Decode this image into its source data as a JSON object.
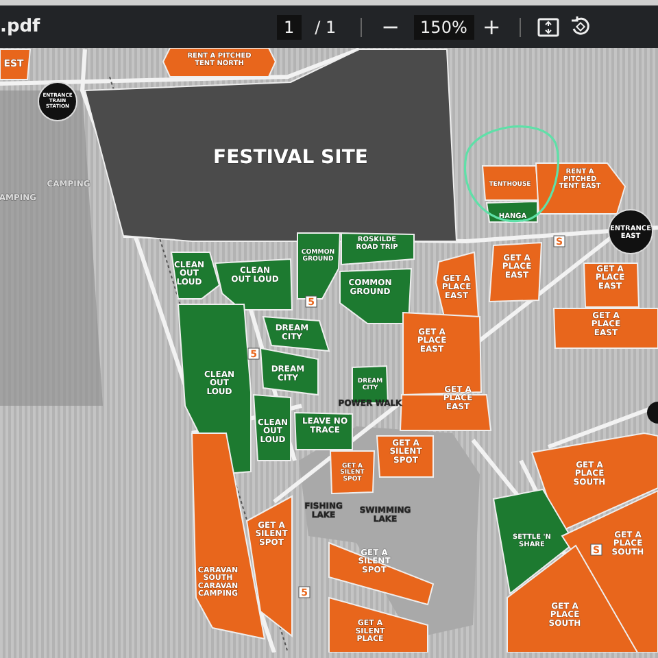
{
  "viewer": {
    "file_name": ".pdf",
    "page": "1",
    "page_total": "/ 1",
    "zoom_out": "−",
    "zoom": "150%",
    "zoom_in": "+"
  },
  "map": {
    "areas": [
      {
        "kind": "camping",
        "lines": [
          "EST"
        ]
      },
      {
        "kind": "camping",
        "lines": [
          "RENT A PITCHED",
          "TENT NORTH"
        ]
      },
      {
        "kind": "site",
        "lines": [
          "FESTIVAL SITE"
        ]
      },
      {
        "kind": "camping",
        "lines": [
          "TENTHOUSE"
        ]
      },
      {
        "kind": "camping",
        "lines": [
          "RENT A",
          "PITCHED",
          "TENT EAST"
        ]
      },
      {
        "kind": "green",
        "lines": [
          "HANGA"
        ]
      },
      {
        "kind": "green",
        "lines": [
          "CLEAN",
          "OUT",
          "LOUD"
        ]
      },
      {
        "kind": "green",
        "lines": [
          "CLEAN",
          "OUT LOUD"
        ]
      },
      {
        "kind": "green",
        "lines": [
          "COMMON",
          "GROUND"
        ]
      },
      {
        "kind": "green",
        "lines": [
          "ROSKILDE",
          "ROAD TRIP"
        ]
      },
      {
        "kind": "green",
        "lines": [
          "COMMON",
          "GROUND"
        ]
      },
      {
        "kind": "camping",
        "lines": [
          "GET A",
          "PLACE",
          "EAST"
        ]
      },
      {
        "kind": "camping",
        "lines": [
          "GET A",
          "PLACE",
          "EAST"
        ]
      },
      {
        "kind": "camping",
        "lines": [
          "GET A",
          "PLACE",
          "EAST"
        ]
      },
      {
        "kind": "camping",
        "lines": [
          "GET A",
          "PLACE",
          "EAST"
        ]
      },
      {
        "kind": "green",
        "lines": [
          "DREAM",
          "CITY"
        ]
      },
      {
        "kind": "green",
        "lines": [
          "CLEAN",
          "OUT",
          "LOUD"
        ]
      },
      {
        "kind": "green",
        "lines": [
          "DREAM",
          "CITY"
        ]
      },
      {
        "kind": "green",
        "lines": [
          "DREAM",
          "CITY"
        ]
      },
      {
        "kind": "green",
        "lines": [
          "CLEAN",
          "OUT",
          "LOUD"
        ]
      },
      {
        "kind": "green",
        "lines": [
          "LEAVE NO",
          "TRACE"
        ]
      },
      {
        "kind": "camping",
        "lines": [
          "GET A",
          "PLACE",
          "EAST"
        ]
      },
      {
        "kind": "camping",
        "lines": [
          "GET A",
          "PLACE",
          "EAST"
        ]
      },
      {
        "kind": "camping",
        "lines": [
          "GET A",
          "SILENT",
          "SPOT"
        ]
      },
      {
        "kind": "camping",
        "lines": [
          "GET A",
          "SILENT",
          "SPOT"
        ]
      },
      {
        "kind": "camping",
        "lines": [
          "GET A",
          "PLACE",
          "SOUTH"
        ]
      },
      {
        "kind": "camping",
        "lines": [
          "GET A",
          "SILENT",
          "SPOT"
        ]
      },
      {
        "kind": "green",
        "lines": [
          "SETTLE 'N",
          "SHARE"
        ]
      },
      {
        "kind": "camping",
        "lines": [
          "GET A",
          "PLACE",
          "SOUTH"
        ]
      },
      {
        "kind": "camping",
        "lines": [
          "CARAVAN",
          "SOUTH",
          "CARAVAN",
          "CAMPING"
        ]
      },
      {
        "kind": "camping",
        "lines": [
          "GET A",
          "SILENT",
          "SPOT"
        ]
      },
      {
        "kind": "camping",
        "lines": [
          "GET A",
          "SILENT",
          "PLACE"
        ]
      },
      {
        "kind": "camping",
        "lines": [
          "GET A",
          "PLACE",
          "SOUTH"
        ]
      }
    ],
    "entrances": [
      {
        "lines": [
          "ENTRANCE",
          "TRAIN",
          "STATION"
        ]
      },
      {
        "lines": [
          "ENTRANCE",
          "EAST"
        ]
      }
    ],
    "place_labels": [
      {
        "lines": [
          "CAMPING"
        ]
      },
      {
        "lines": [
          "AMPING"
        ]
      },
      {
        "lines": [
          "POWER WALK"
        ]
      },
      {
        "lines": [
          "FISHING",
          "LAKE"
        ]
      },
      {
        "lines": [
          "SWIMMING",
          "LAKE"
        ]
      }
    ],
    "signs": [
      "5",
      "5",
      "5",
      "S",
      "S"
    ]
  }
}
